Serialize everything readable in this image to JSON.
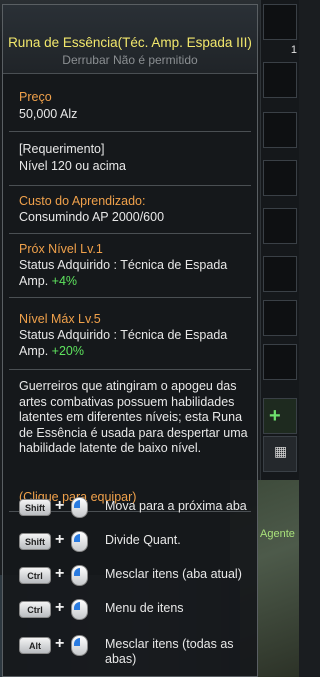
{
  "background": {
    "map_label": "Agente",
    "slot_count": "1"
  },
  "tooltip": {
    "title": "Runa de Essência(Téc. Amp. Espada III)",
    "subtitle": "Derrubar Não é permitido",
    "price_label": "Preço",
    "price_value": "50,000 Alz",
    "req_header": "[Requerimento]",
    "req_value": "Nível 120 ou acima",
    "cost_label": "Custo do Aprendizado:",
    "cost_value": "Consumindo AP 2000/600",
    "next_level_label": "Próx Nível Lv.1",
    "next_status_text": "Status Adquirido : Técnica de Espada",
    "next_status_amp": "Amp.",
    "next_status_bonus": "+4%",
    "max_level_label": "Nível Máx Lv.5",
    "max_status_text": "Status Adquirido : Técnica de Espada",
    "max_status_amp": "Amp.",
    "max_status_bonus": "+20%",
    "description": "Guerreiros que atingiram o apogeu das artes combativas possuem habilidades latentes em diferentes níveis; esta Runa de Essência é usada para despertar uma habilidade latente de baixo nível.",
    "click_hint": "(Clique para equipar)"
  },
  "shortcuts": [
    {
      "key": "Shift",
      "text": "Mova para a próxima aba"
    },
    {
      "key": "Shift",
      "text": "Divide Quant."
    },
    {
      "key": "Ctrl",
      "text": "Mesclar itens (aba atual)"
    },
    {
      "key": "Ctrl",
      "text": "Menu de itens"
    },
    {
      "key": "Alt",
      "text": "Mesclar itens (todas as abas)"
    }
  ]
}
